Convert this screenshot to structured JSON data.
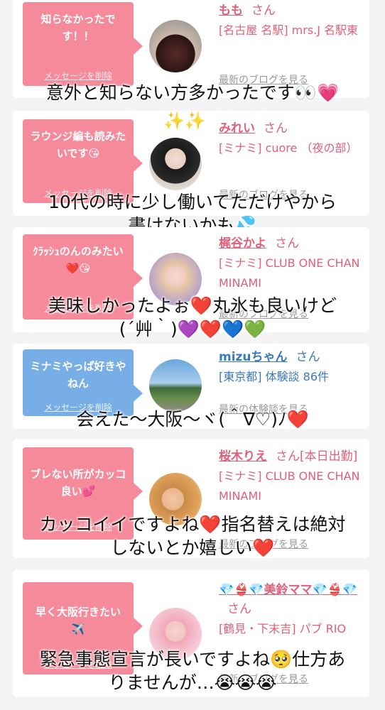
{
  "messages": [
    {
      "bubble": "知らなかったです！！",
      "bubble_color": "#f48a9a",
      "delete": "メッセージを削除",
      "name": "もも",
      "honorific": "さん",
      "location": "[名古屋 名駅] mrs.J 名駅東",
      "link": "最新のブログを見る",
      "caption": "意外と知らない方多かったです👀💗"
    },
    {
      "bubble": "ラウンジ編も読みたいです😘",
      "bubble_color": "#f48a9a",
      "delete": "メッセージを削除",
      "name": "みれい",
      "honorific": "さん",
      "location": "[ミナミ] cuore （夜の部）",
      "link": "最新のブログを見る",
      "caption_line1": "10代の時に少し働いてただけやから",
      "caption_line2": "書けないかも💦"
    },
    {
      "bubble": "ｸﾗｯｼｭのんのみたい❤️😘",
      "bubble_color": "#f48a9a",
      "delete": "メッセージを削除",
      "name": "梶谷かよ",
      "honorific": "さん",
      "location": "[ミナミ] CLUB ONE CHAN MINAMI",
      "link": "最新のブログを見る",
      "caption_line1": "美味しかったよぉ❤️丸氷も良いけど",
      "caption_line2": "(´艸｀)💜❤️💙💚"
    },
    {
      "bubble": "ミナミやっぱ好きやねん",
      "bubble_color": "#77aee6",
      "delete": "メッセージを削除",
      "name": "mizuちゃん",
      "honorific": "さん",
      "location": "[東京都] 体験談 86件",
      "link": "最新の体験談を見る",
      "caption": "会えた〜大阪〜ヾ(＾∇♡)ﾉ❤️"
    },
    {
      "bubble": "ブレない所がカッコ良い💕",
      "bubble_color": "#f48a9a",
      "delete": "メッセージを削除",
      "name": "桜木りえ",
      "honorific": "さん[本日出勤]",
      "location": "[ミナミ] CLUB ONE CHAN MINAMI",
      "link": "最新のブログを見る",
      "caption_line1": "カッコイイですよね❤️指名替えは絶対",
      "caption_line2": "しないとか嬉しい❤️"
    },
    {
      "bubble": "早く大阪行きたい✈️",
      "bubble_color": "#f48a9a",
      "delete": "メッセージを削除",
      "name": "💎👙💎美鈴ママ💎👙💎",
      "honorific": "さん",
      "location": "[鶴見・下末吉] パブ RIO",
      "link": "最新のブログを見る",
      "caption_line1": "緊急事態宣言が長いですよね🥺仕方あ",
      "caption_line2": "りませんが…😭😭😭"
    }
  ],
  "sparkle": "✨✨"
}
